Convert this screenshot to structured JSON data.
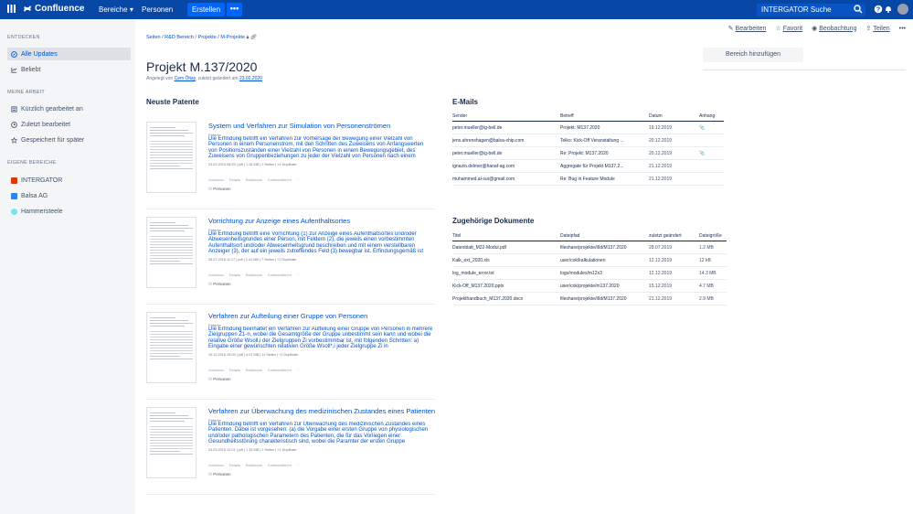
{
  "topbar": {
    "logo": "Confluence",
    "nav_bereiche": "Bereiche",
    "nav_personen": "Personen",
    "create": "Erstellen",
    "more": "•••",
    "search_value": "INTERGATOR Suche"
  },
  "sidebar": {
    "entdecken": "ENTDECKEN",
    "alle_updates": "Alle Updates",
    "beliebt": "Beliebt",
    "meine_arbeit": "MEINE ARBEIT",
    "kuerzlich": "Kürzlich gearbeitet an",
    "zuletzt": "Zuletzt bearbeitet",
    "gespeichert": "Gespeichert für später",
    "eigene_bereiche": "EIGENE BEREICHE",
    "spaces": [
      {
        "label": "INTERGATOR",
        "color": "#de350b"
      },
      {
        "label": "Balsa AG",
        "color": "#2684ff"
      },
      {
        "label": "Hammersteele",
        "color": "#79e2f2"
      }
    ]
  },
  "page": {
    "breadcrumb": "Seiten / R&D Bereich / Projekte / M-Projekte",
    "actions": {
      "edit": "Bearbeiten",
      "fav": "Favorit",
      "watch": "Beobachtung",
      "share": "Teilen",
      "more": "•••"
    },
    "title": "Projekt M.137/2020",
    "byline_prefix": "Angelegt von",
    "author": "Cem Öltay",
    "byline_mid": ", zuletzt geändert am",
    "modified": "23.02.2020",
    "add_area": "Bereich hinzufügen"
  },
  "patents": {
    "heading": "Neuste Patente",
    "items": [
      {
        "title": "System und Verfahren zur Simulation von Personenströmen",
        "type": "Patente",
        "desc": "Die Erfindung betrifft ein Verfahren zur Vorhersage der Bewegung einer Vielzahl von Personen in einem Personenstrom, mit den Schritten des Zuweisens von Anfangswerten von Positionszuständen einer Vielzahl von Personen in einem Bewegungsgebiet, des Zuweisens von Gruppenbeziehungen zu jeder der Vielzahl von Personen nach einem",
        "meta": "23.02.2019 08:25 | pdf | 1.26 MB | 2 Seiten | +4 Duplikate",
        "person": "Personen"
      },
      {
        "title": "Vorrichtung zur Anzeige eines Aufenthaltsortes",
        "type": "Patente",
        "desc": "Die Erfindung betrifft eine Vorrichtung (1) zur Anzeige eines Aufenthaltsortes und/oder Abwesenheitsgrundes einer Person, mit Feldern (2), die jeweils einen vorbestimmten Aufenthaltsort und/oder Abwesenheitsgrund beschreiben und mit einem verstellbaren Anzeiger (3), der auf ein jeweils zutreffendes Feld (3) bewegbar ist. Erfindungsgemäß ist",
        "meta": "28.07.2018 11:17 | pdf | 2.41 MB | 7 Seiten | +1 Duplikate",
        "person": "Personen"
      },
      {
        "title": "Verfahren zur Aufteilung einer Gruppe von Personen",
        "type": "Patente",
        "desc": "Die Erfindung beinhaltet ein Verfahren zur Aufteilung einer Gruppe von Personen in mehrere Zielgruppen Z1-n, wobei die Gesamtgröße der Gruppe unbestimmt sein kann und wobei die relative Größe Wsoll,i der Zielgruppen Zi vorbestimmbar ist, mit folgenden Schritten: a) Eingabe einer gewünschten relativen Größe Wsoll*,i jeder Zielgruppe Zi in",
        "meta": "19.12.2016 15:09 | pdf | 4.07 MB | 11 Seiten | +2 Duplikate",
        "person": "Personen"
      },
      {
        "title": "Verfahren zur Überwachung des medizinischen Zustandes eines Patienten",
        "type": "Patente",
        "desc": "Die Erfindung betrifft ein Verfahren zur Überwachung des medizinischen Zustandes eines Patienten. Dabei ist vorgesehen: (a) die Vorgabe einer ersten Gruppe von physiologischen und/oder pathologischen Parametern des Patienten, die für das Vorliegen einer Gesundheitsstörung charakteristisch sind, wobei die Paramter der ersten Gruppe",
        "meta": "24.03.2015 12:01 | pdf | 1.33 MB | 2 Seiten | +1 Duplikate",
        "person": "Personen"
      }
    ],
    "action_labels": [
      "Vorschau",
      "Details",
      "Bookmark",
      "Kommentieren",
      "···"
    ]
  },
  "emails": {
    "heading": "E-Mails",
    "columns": [
      "Sender",
      "Betreff",
      "Datum",
      "Anhang"
    ],
    "rows": [
      [
        "peter.mueller@ig-bell.de",
        "Projekt: M137.2020",
        "19.12.2019",
        "📎"
      ],
      [
        "jens.ahrenshagen@balsa-ship.com",
        "Telko: Kick-Off Veranstaltung ...",
        "20.12.2019",
        ""
      ],
      [
        "peter.mueller@ig-bell.de",
        "Re: Projekt: M137.2020",
        "20.12.2019",
        "📎"
      ],
      [
        "ignazio.delmer@hanaf-ag.com",
        "Aggregate für Projekt M137.2...",
        "21.12.2019",
        ""
      ],
      [
        "muhammed.al-sur@gmail.com",
        "Re: Bug in Feature Module",
        "21.12.2019",
        ""
      ]
    ]
  },
  "docs": {
    "heading": "Zugehörige Dokumente",
    "columns": [
      "Titel",
      "Dateipfad",
      "zuletzt geändert",
      "Dateigröße"
    ],
    "rows": [
      [
        "Datenblatt_M22-Modul.pdf",
        "fileshare/projekte/i6d/M137.2020",
        "28.07.2019",
        "1.2 MB"
      ],
      [
        "Kalk_ext_2020.xls",
        "user/cok/kalkulationen",
        "12.12.2019",
        "12 kB"
      ],
      [
        "log_module_error.txt",
        "logs/modules/m12x3",
        "12.12.2019",
        "14.3 MB"
      ],
      [
        "Kick-Off_M137.2020.pptx",
        "user/cok/projekte/m137.2020",
        "19.12.2019",
        "4.7 MB"
      ],
      [
        "Projekthandbuch_M137.2020.docx",
        "fileshare/projekte/i6d/M137.2020",
        "21.12.2019",
        "2.9 MB"
      ]
    ]
  }
}
